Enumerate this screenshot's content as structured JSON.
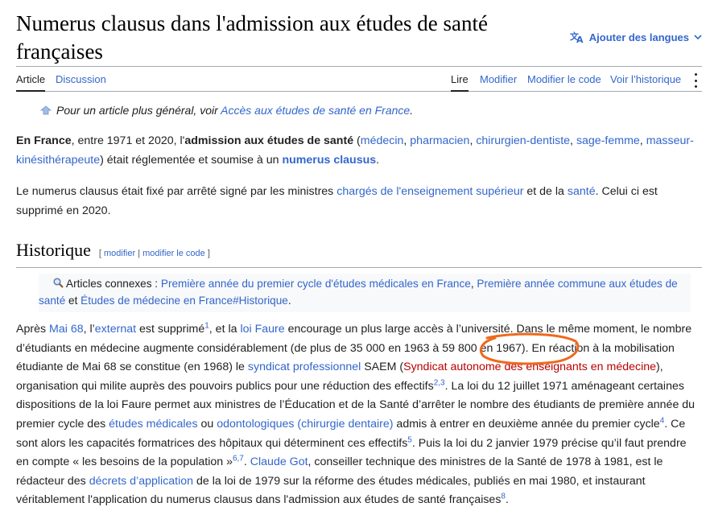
{
  "title": "Numerus clausus dans l'admission aux études de santé françaises",
  "languages_label": "Ajouter des langues",
  "tabs_left": [
    "Article",
    "Discussion"
  ],
  "tabs_right": [
    "Lire",
    "Modifier",
    "Modifier le code",
    "Voir l’historique"
  ],
  "hatnote": {
    "prefix": "Pour un article plus général, voir ",
    "link": "Accès aux études de santé en France",
    "suffix": "."
  },
  "p1": {
    "b1": "En France",
    "t1": ", entre 1971 et 2020, l'",
    "b2": "admission aux études de santé",
    "t2": " (",
    "l1": "médecin",
    "l2": "pharmacien",
    "l3": "chirurgien-dentiste",
    "l4": "sage-femme",
    "l5": "masseur-kinésithérapeute",
    "t3": ") était réglementée et soumise à un ",
    "b3": "numerus clausus",
    "t4": "."
  },
  "p2": {
    "t1": "Le numerus clausus était fixé par arrêté signé par les ministres ",
    "l1": "chargés de l'enseignement supérieur",
    "t2": " et de la ",
    "l2": "santé",
    "t3": ". Celui ci est supprimé en 2020."
  },
  "section": {
    "heading": "Historique",
    "edit1": "modifier",
    "edit2": "modifier le code"
  },
  "connex": {
    "label": "Articles connexes : ",
    "l1": "Première année du premier cycle d'études médicales en France",
    "l2": "Première année commune aux études de santé",
    "t1": " et ",
    "l3": "Études de médecine en France#Historique"
  },
  "p3": {
    "t1": "Après ",
    "l1": "Mai 68",
    "t2": ", l’",
    "l2": "externat",
    "t3": " est supprimé",
    "s1": "1",
    "t4": ", et la ",
    "l3": "loi Faure",
    "t5": " encourage un plus large accès à l’université. Dans le même moment, le nombre d’étudiants en médecine augmente considérablement (de plus de 35 000 en 1963 à 59 800 en 1967). En réaction à la mobilisation étudiante de Mai 68 se constitue (en 1968) le ",
    "l4": "syndicat professionnel",
    "t6": " SAEM (",
    "r1": "Syndicat autonome des enseignants en médecine",
    "t7": "), organisation qui milite auprès des pouvoirs publics pour une réduction des effectifs",
    "s2": "2,3",
    "t8": ". La loi du 12 juillet 1971 aménageant certaines dispositions de la loi Faure permet aux ministres de l’Éducation et de la Santé d’arrêter le nombre des étudiants de première année du premier cycle des ",
    "l5": "études médicales",
    "t9": " ou ",
    "l6": "odontologiques (chirurgie dentaire)",
    "t10": " admis à entrer en deuxième année du premier cycle",
    "s3": "4",
    "t11": ". Ce sont alors les capacités formatrices des hôpitaux qui déterminent ces effectifs",
    "s4": "5",
    "t12": ". Puis la loi du 2 janvier 1979 précise qu’il faut prendre en compte « les besoins de la population »",
    "s5": "6,7",
    "t13": ". ",
    "l7": "Claude Got",
    "t14": ", conseiller technique des ministres de la Santé de 1978 à 1981, est le rédacteur des ",
    "l8": "décrets d’application",
    "t15": " de la loi de 1979 sur la réforme des études médicales, publiés en mai 1980, et instaurant véritablement l'application du numerus clausus dans l'admission aux études de santé françaises",
    "s6": "8",
    "t16": "."
  },
  "colors": {
    "link": "#3366cc",
    "redlink": "#ba0000",
    "annotation": "#ee6a1c"
  }
}
